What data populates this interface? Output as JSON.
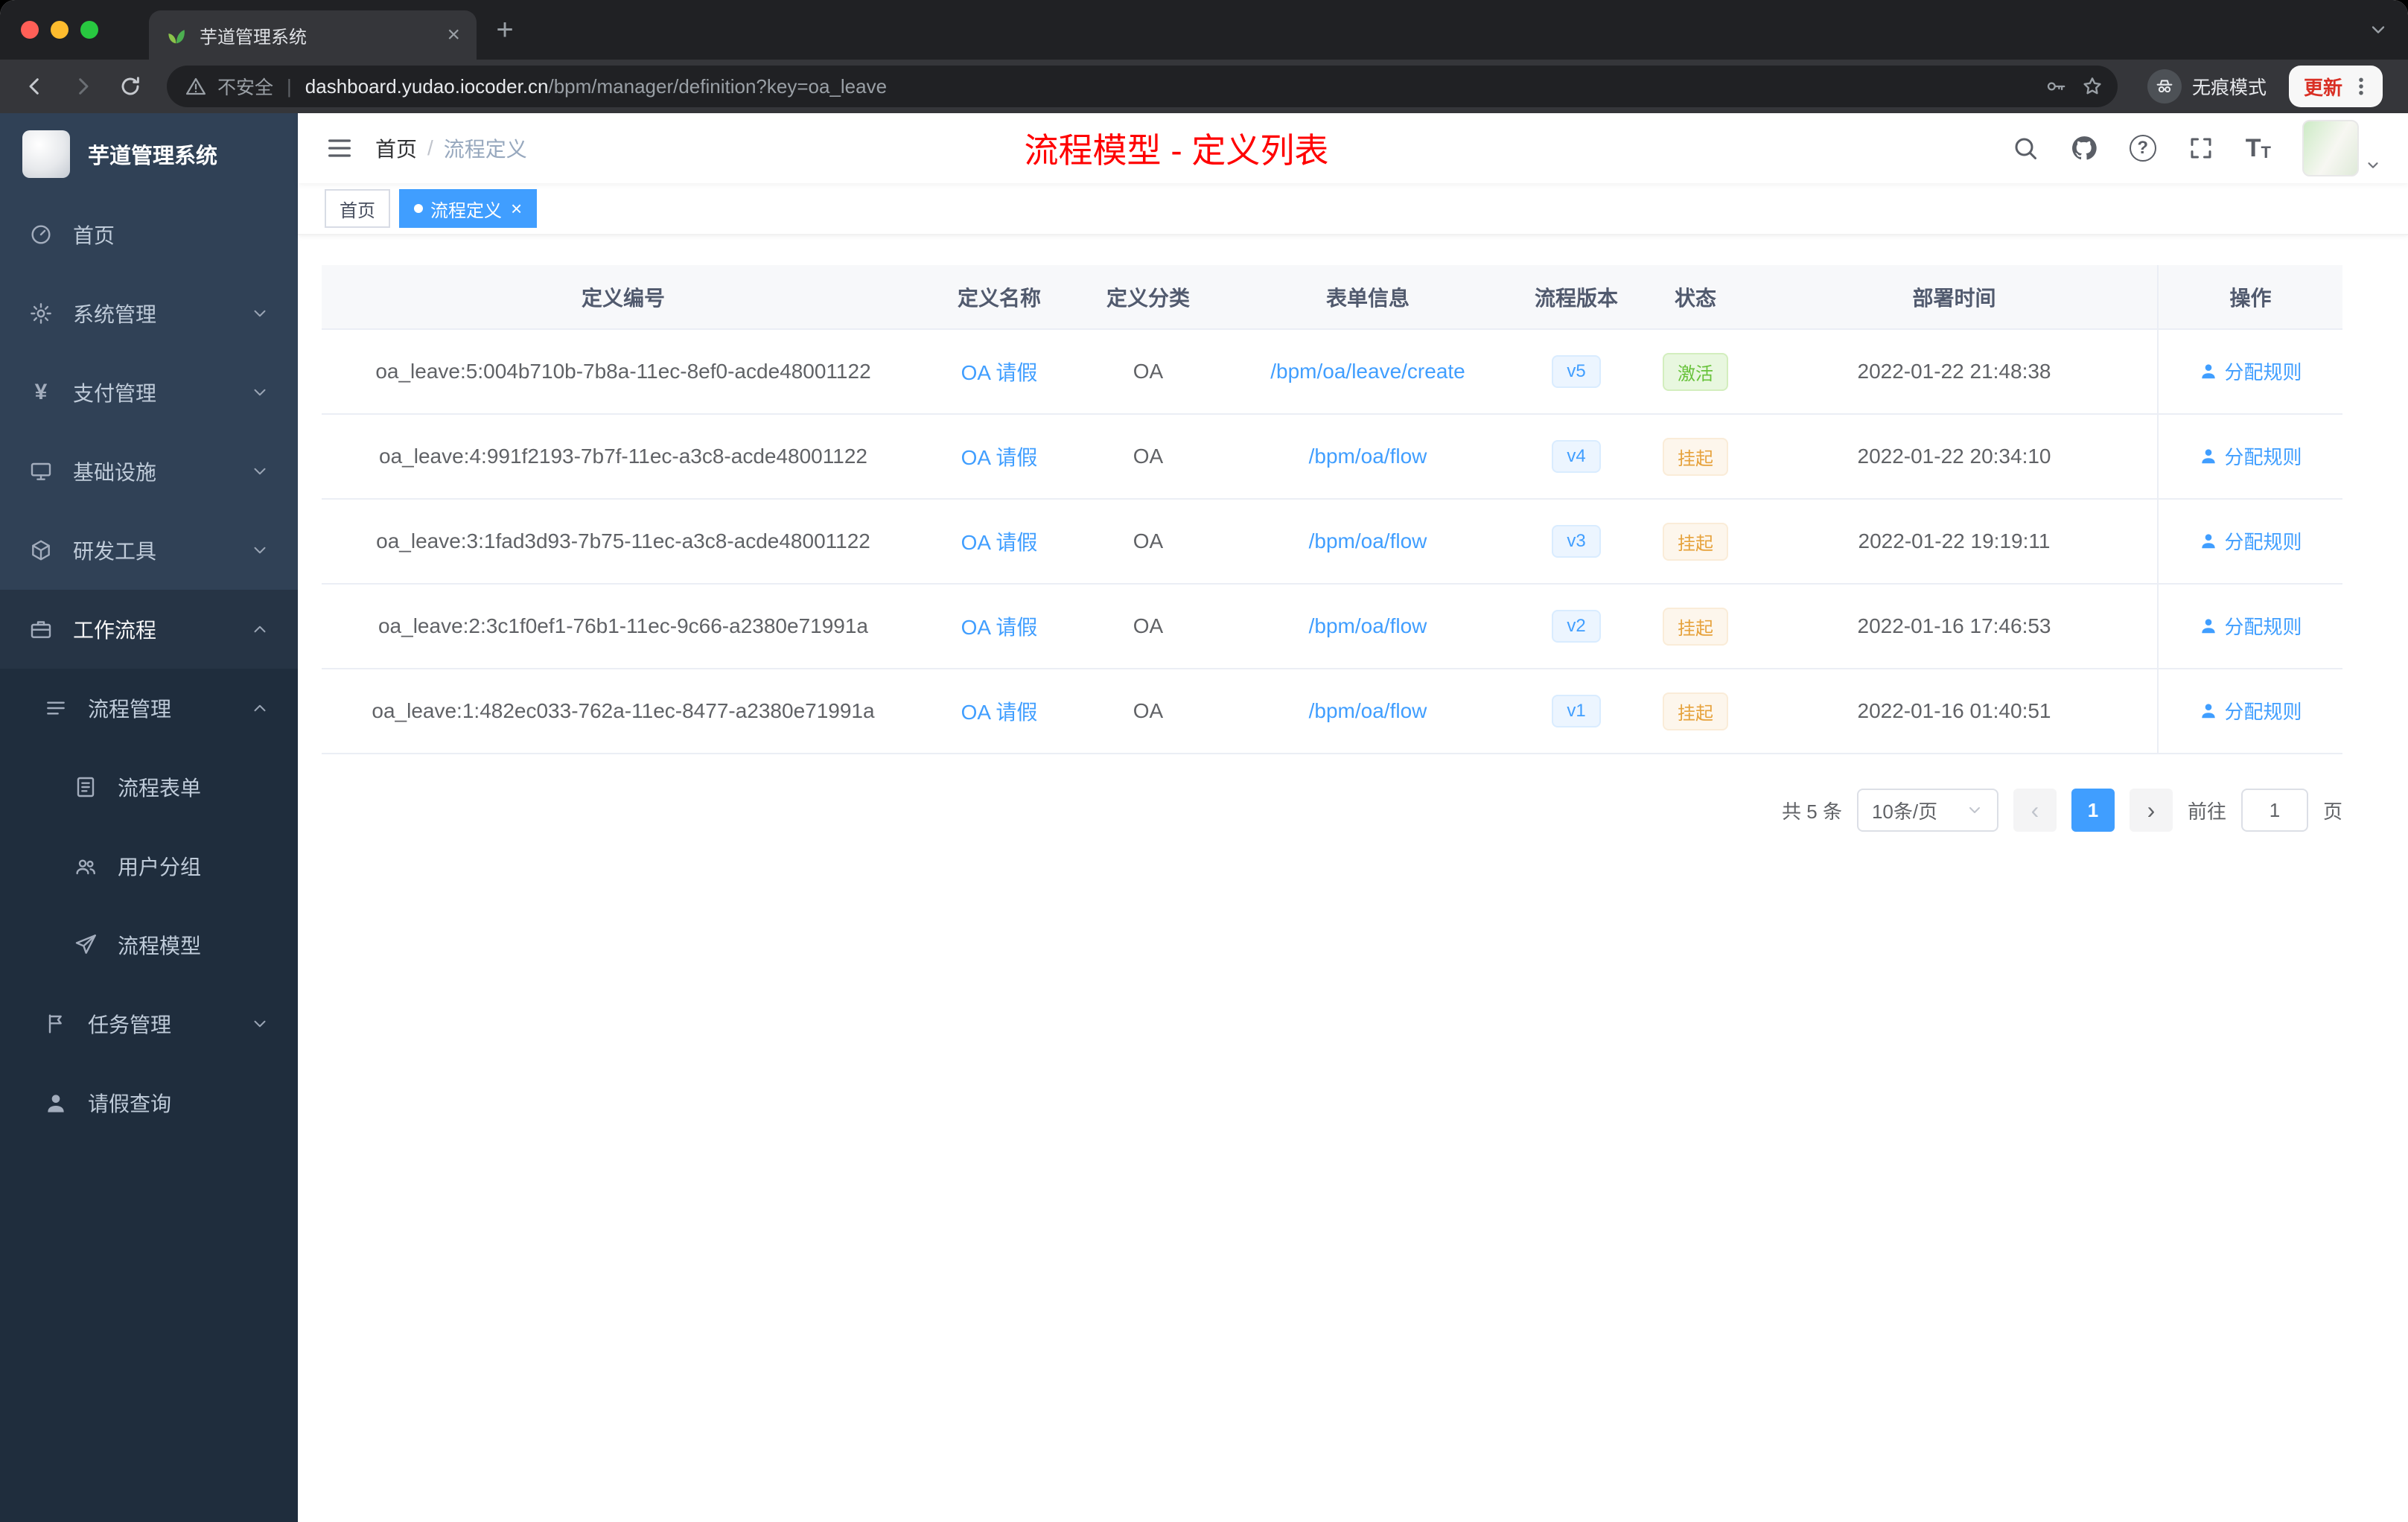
{
  "colors": {
    "accent": "#409eff",
    "success": "#67c23a",
    "warning": "#e6a23c",
    "title_red": "#ff0000",
    "sidebar_bg": "#304156",
    "submenu_bg": "#1f2d3d"
  },
  "browser": {
    "tab_title": "芋道管理系统",
    "security_label": "不安全",
    "url_host": "dashboard.yudao.iocoder.cn",
    "url_path": "/bpm/manager/definition?key=oa_leave",
    "incognito_label": "无痕模式",
    "update_label": "更新"
  },
  "sidebar": {
    "logo_title": "芋道管理系统",
    "items": [
      {
        "name": "home",
        "label": "首页",
        "icon": "dashboard",
        "level": 1
      },
      {
        "name": "system-management",
        "label": "系统管理",
        "icon": "gear",
        "level": 1,
        "chevron": "down"
      },
      {
        "name": "payment-management",
        "label": "支付管理",
        "icon": "yen",
        "level": 1,
        "chevron": "down"
      },
      {
        "name": "infrastructure",
        "label": "基础设施",
        "icon": "infra",
        "level": 1,
        "chevron": "down"
      },
      {
        "name": "dev-tools",
        "label": "研发工具",
        "icon": "tools",
        "level": 1,
        "chevron": "down"
      },
      {
        "name": "workflow",
        "label": "工作流程",
        "icon": "workflow",
        "level": 1,
        "chevron": "up",
        "active": true
      },
      {
        "name": "process-management",
        "label": "流程管理",
        "icon": "process",
        "level": 2,
        "chevron": "up"
      },
      {
        "name": "process-form",
        "label": "流程表单",
        "icon": "form",
        "level": 3
      },
      {
        "name": "user-group",
        "label": "用户分组",
        "icon": "group",
        "level": 3
      },
      {
        "name": "process-model",
        "label": "流程模型",
        "icon": "model",
        "level": 3
      },
      {
        "name": "task-management",
        "label": "任务管理",
        "icon": "task",
        "level": 2,
        "chevron": "down"
      },
      {
        "name": "leave-query",
        "label": "请假查询",
        "icon": "user",
        "level": 2
      }
    ]
  },
  "header": {
    "breadcrumb": [
      "首页",
      "流程定义"
    ],
    "breadcrumb_separator": "/",
    "page_title": "流程模型 - 定义列表"
  },
  "tags": [
    {
      "label": "首页",
      "active": false
    },
    {
      "label": "流程定义",
      "active": true
    }
  ],
  "table": {
    "columns": [
      "定义编号",
      "定义名称",
      "定义分类",
      "表单信息",
      "流程版本",
      "状态",
      "部署时间",
      "操作"
    ],
    "rows": [
      {
        "id": "oa_leave:5:004b710b-7b8a-11ec-8ef0-acde48001122",
        "name": "OA 请假",
        "category": "OA",
        "form": "/bpm/oa/leave/create",
        "version": "v5",
        "status": "激活",
        "status_type": "success",
        "deploy_time": "2022-01-22 21:48:38",
        "action": "分配规则"
      },
      {
        "id": "oa_leave:4:991f2193-7b7f-11ec-a3c8-acde48001122",
        "name": "OA 请假",
        "category": "OA",
        "form": "/bpm/oa/flow",
        "version": "v4",
        "status": "挂起",
        "status_type": "warning",
        "deploy_time": "2022-01-22 20:34:10",
        "action": "分配规则"
      },
      {
        "id": "oa_leave:3:1fad3d93-7b75-11ec-a3c8-acde48001122",
        "name": "OA 请假",
        "category": "OA",
        "form": "/bpm/oa/flow",
        "version": "v3",
        "status": "挂起",
        "status_type": "warning",
        "deploy_time": "2022-01-22 19:19:11",
        "action": "分配规则"
      },
      {
        "id": "oa_leave:2:3c1f0ef1-76b1-11ec-9c66-a2380e71991a",
        "name": "OA 请假",
        "category": "OA",
        "form": "/bpm/oa/flow",
        "version": "v2",
        "status": "挂起",
        "status_type": "warning",
        "deploy_time": "2022-01-16 17:46:53",
        "action": "分配规则"
      },
      {
        "id": "oa_leave:1:482ec033-762a-11ec-8477-a2380e71991a",
        "name": "OA 请假",
        "category": "OA",
        "form": "/bpm/oa/flow",
        "version": "v1",
        "status": "挂起",
        "status_type": "warning",
        "deploy_time": "2022-01-16 01:40:51",
        "action": "分配规则"
      }
    ]
  },
  "pagination": {
    "total_label": "共 5 条",
    "page_size": "10条/页",
    "current_page": "1",
    "goto_label": "前往",
    "goto_value": "1",
    "page_unit": "页"
  }
}
